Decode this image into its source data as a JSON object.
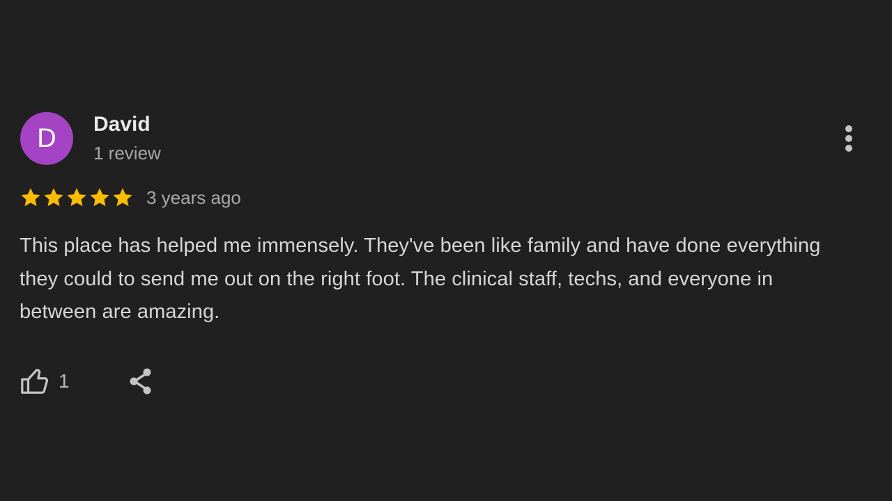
{
  "reviewer": {
    "initial": "D",
    "avatar_color": "#a443c4",
    "name": "David",
    "review_count": "1 review"
  },
  "rating": {
    "stars": 5,
    "max_stars": 5,
    "star_color": "#fbbc04",
    "date": "3 years ago"
  },
  "review": {
    "text": "This place has helped me immensely. They've been like family and have done everything they could to send me out on the right foot. The clinical staff, techs, and everyone in between are amazing."
  },
  "actions": {
    "like_icon": "thumbs-up-icon",
    "like_count": "1",
    "share_icon": "share-icon",
    "more_icon": "more-vertical-icon"
  },
  "colors": {
    "background": "#202020",
    "text_primary": "#e8e8e8",
    "text_secondary": "#a8a8a8",
    "icon": "#c4c4c4"
  }
}
